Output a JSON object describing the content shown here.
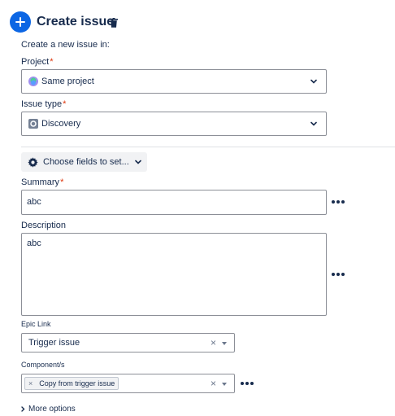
{
  "header": {
    "title": "Create issue"
  },
  "intro": "Create a new issue in:",
  "project": {
    "label": "Project",
    "required_mark": "*",
    "value": "Same project"
  },
  "issue_type": {
    "label": "Issue type",
    "required_mark": "*",
    "value": "Discovery"
  },
  "choose_fields": {
    "label": "Choose fields to set..."
  },
  "summary": {
    "label": "Summary",
    "required_mark": "*",
    "value": "abc"
  },
  "description": {
    "label": "Description",
    "value": "abc"
  },
  "epic_link": {
    "label": "Epic Link",
    "value": "Trigger issue",
    "clear": "×"
  },
  "components": {
    "label": "Component/s",
    "tag": "Copy from trigger issue",
    "tag_remove": "×",
    "clear": "×"
  },
  "more_options": {
    "label": "More options"
  },
  "colors": {
    "accent": "#0c66e4",
    "required": "#de350b",
    "text": "#172b4d",
    "border": "#8c8f97"
  },
  "icons": [
    "add-icon",
    "trash-icon",
    "project-avatar-icon",
    "discovery-icon",
    "chevron-down-icon",
    "gear-icon",
    "more-icon",
    "chevron-right-icon"
  ]
}
